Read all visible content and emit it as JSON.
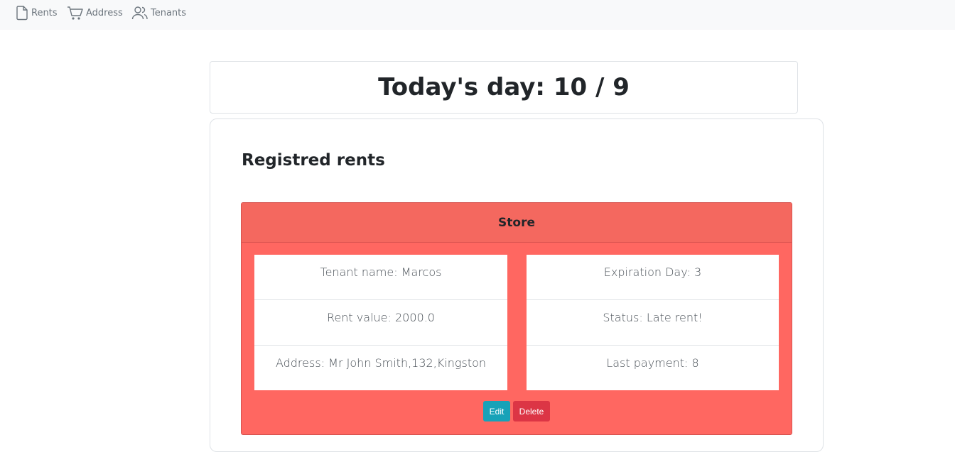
{
  "navbar": {
    "items": [
      {
        "label": "Rents",
        "icon": "file-icon"
      },
      {
        "label": "Address",
        "icon": "cart-icon"
      },
      {
        "label": "Tenants",
        "icon": "people-icon"
      }
    ]
  },
  "today": {
    "title": "Today's day: 10 / 9"
  },
  "rents": {
    "heading": "Registred rents",
    "card": {
      "title": "Store",
      "left": [
        "Tenant name: Marcos",
        "Rent value: 2000.0",
        "Address: Mr John Smith,132,Kingston"
      ],
      "right": [
        "Expiration Day: 3",
        "Status: Late rent!",
        "Last payment: 8"
      ],
      "edit_label": "Edit",
      "delete_label": "Delete"
    }
  },
  "colors": {
    "card_bg": "#ff6761",
    "card_header": "#f4685f",
    "edit_button": "#17a2b8",
    "delete_button": "#dc3545",
    "navbar_bg": "#f8f9fa"
  }
}
